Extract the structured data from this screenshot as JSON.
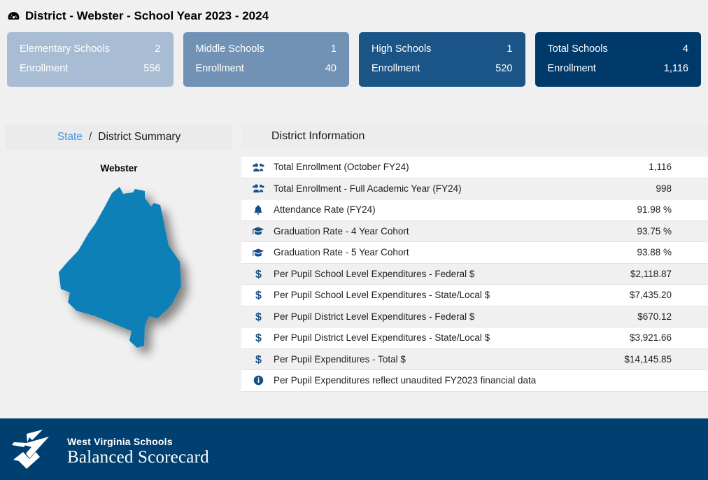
{
  "header": {
    "icon": "tachometer-icon",
    "title": "District - Webster - School Year 2023 - 2024"
  },
  "cards": [
    {
      "label": "Elementary Schools",
      "value": "2",
      "sub_label": "Enrollment",
      "sub_value": "556",
      "color": "#a8bdd4"
    },
    {
      "label": "Middle Schools",
      "value": "1",
      "sub_label": "Enrollment",
      "sub_value": "40",
      "color": "#7292b5"
    },
    {
      "label": "High Schools",
      "value": "1",
      "sub_label": "Enrollment",
      "sub_value": "520",
      "color": "#1b5588"
    },
    {
      "label": "Total Schools",
      "value": "4",
      "sub_label": "Enrollment",
      "sub_value": "1,116",
      "color": "#003a6b"
    }
  ],
  "breadcrumb": {
    "link": "State",
    "separator": "/",
    "current": "District Summary"
  },
  "map": {
    "title": "Webster",
    "fill_color": "#1180b8",
    "icon": "county-map-shape"
  },
  "info": {
    "header": "District Information",
    "rows": [
      {
        "icon": "users-icon",
        "label": "Total Enrollment (October FY24)",
        "value": "1,116"
      },
      {
        "icon": "users-icon",
        "label": "Total Enrollment - Full Academic Year (FY24)",
        "value": "998"
      },
      {
        "icon": "bell-icon",
        "label": "Attendance Rate (FY24)",
        "value": "91.98 %"
      },
      {
        "icon": "graduation-cap-icon",
        "label": "Graduation Rate - 4 Year Cohort",
        "value": "93.75 %"
      },
      {
        "icon": "graduation-cap-icon",
        "label": "Graduation Rate - 5 Year Cohort",
        "value": "93.88 %"
      },
      {
        "icon": "dollar-icon",
        "label": "Per Pupil School Level Expenditures - Federal $",
        "value": "$2,118.87"
      },
      {
        "icon": "dollar-icon",
        "label": "Per Pupil School Level Expenditures - State/Local $",
        "value": "$7,435.20"
      },
      {
        "icon": "dollar-icon",
        "label": "Per Pupil District Level Expenditures - Federal $",
        "value": "$670.12"
      },
      {
        "icon": "dollar-icon",
        "label": "Per Pupil District Level Expenditures - State/Local $",
        "value": "$3,921.66"
      },
      {
        "icon": "dollar-icon",
        "label": "Per Pupil Expenditures - Total $",
        "value": "$14,145.85"
      },
      {
        "icon": "info-circle-icon",
        "label": "Per Pupil Expenditures reflect unaudited FY2023 financial data",
        "value": ""
      }
    ]
  },
  "footer": {
    "logo_icon": "wv-schools-star-logo",
    "logo_line1": "West Virginia Schools",
    "logo_line2": "Balanced Scorecard",
    "background_color": "#004070"
  }
}
